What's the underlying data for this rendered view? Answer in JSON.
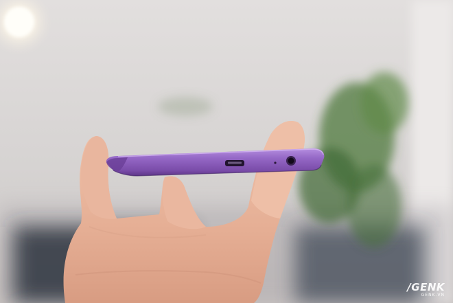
{
  "watermark": {
    "brand": "/GENK",
    "domain": "GENK.VN"
  },
  "colors": {
    "phone_purple": "#8a5ab8",
    "skin": "#e8b59d",
    "background": "#d9d6d4",
    "plant_green": "#4f7a3e"
  },
  "objects": [
    "hand-holding-phone",
    "phone-bottom-edge-with-microusb-port-mic-hole-and-headphone-jack",
    "blurred-potted-plant",
    "blurred-window-light"
  ]
}
